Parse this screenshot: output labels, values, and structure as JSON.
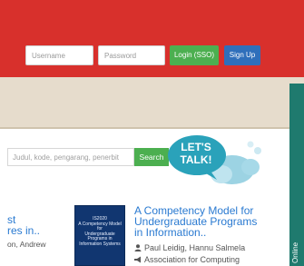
{
  "header": {
    "username_placeholder": "Username",
    "password_placeholder": "Password",
    "login_label": "Login (SSO)",
    "signup_label": "Sign Up"
  },
  "search": {
    "placeholder": "Judul, kode, pengarang, penerbit",
    "button_label": "Search"
  },
  "chat": {
    "line1": "LET'S",
    "line2": "TALK!"
  },
  "sidebar": {
    "label": "Online"
  },
  "results": [
    {
      "title_partial_line1": "st",
      "title_partial_line2": "res in..",
      "author_partial": "on, Andrew"
    },
    {
      "cover_line1": "IS2020",
      "cover_line2": "A Competency Model for",
      "cover_line3": "Undergraduate",
      "cover_line4": "Programs in",
      "cover_line5": "Information Systems",
      "title_line1": "A Competency Model for",
      "title_line2": "Undergraduate Programs",
      "title_line3": "in Information..",
      "authors": "Paul Leidig, Hannu Salmela",
      "publisher": "Association for Computing"
    }
  ],
  "colors": {
    "header_red": "#d8302c",
    "login_green": "#4caf50",
    "signup_blue": "#2f6fbb",
    "link_blue": "#2a7ad1",
    "chat_teal": "#2aa2ba",
    "sidebar_teal": "#1f7a6e"
  }
}
